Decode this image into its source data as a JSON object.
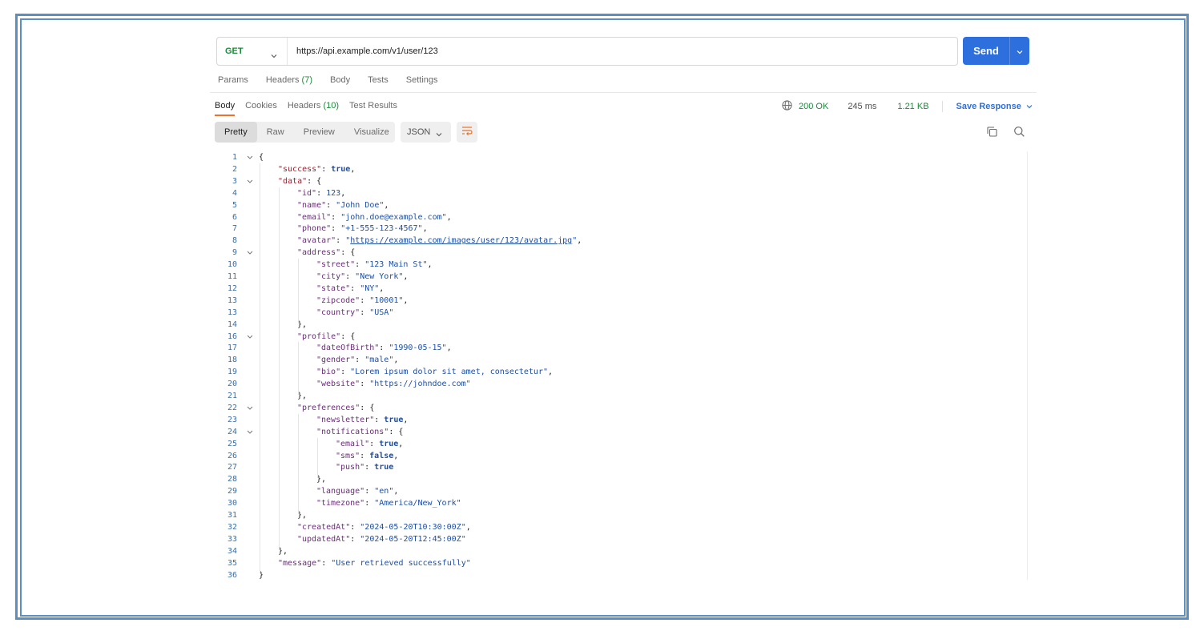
{
  "request": {
    "method": "GET",
    "url": "https://api.example.com/v1/user/123",
    "send_label": "Send",
    "tabs": [
      {
        "label": "Params",
        "count": ""
      },
      {
        "label": "Headers",
        "count": "(7)"
      },
      {
        "label": "Body",
        "count": ""
      },
      {
        "label": "Tests",
        "count": ""
      },
      {
        "label": "Settings",
        "count": ""
      }
    ]
  },
  "response": {
    "tabs": [
      {
        "label": "Body",
        "count": ""
      },
      {
        "label": "Cookies",
        "count": ""
      },
      {
        "label": "Headers",
        "count": "(10)"
      },
      {
        "label": "Test Results",
        "count": ""
      }
    ],
    "status": "200 OK",
    "time": "245 ms",
    "size": "1.21 KB",
    "save_label": "Save Response",
    "views": [
      "Pretty",
      "Raw",
      "Preview",
      "Visualize"
    ],
    "format": "JSON"
  },
  "code_lines": [
    {
      "n": "1",
      "indent": 0,
      "fold": true,
      "tokens": [
        [
          "p",
          "{"
        ]
      ]
    },
    {
      "n": "2",
      "indent": 1,
      "fold": false,
      "tokens": [
        [
          "k",
          "\"success\""
        ],
        [
          "p",
          ": "
        ],
        [
          "b",
          "true"
        ],
        [
          "p",
          ","
        ]
      ]
    },
    {
      "n": "3",
      "indent": 1,
      "fold": true,
      "tokens": [
        [
          "k",
          "\"data\""
        ],
        [
          "p",
          ": {"
        ]
      ]
    },
    {
      "n": "4",
      "indent": 2,
      "fold": false,
      "tokens": [
        [
          "k2",
          "\"id\""
        ],
        [
          "p",
          ": "
        ],
        [
          "n",
          "123"
        ],
        [
          "p",
          ","
        ]
      ]
    },
    {
      "n": "5",
      "indent": 2,
      "fold": false,
      "tokens": [
        [
          "k2",
          "\"name\""
        ],
        [
          "p",
          ": "
        ],
        [
          "s",
          "\"John Doe\""
        ],
        [
          "p",
          ","
        ]
      ]
    },
    {
      "n": "6",
      "indent": 2,
      "fold": false,
      "tokens": [
        [
          "k2",
          "\"email\""
        ],
        [
          "p",
          ": "
        ],
        [
          "s",
          "\"john.doe@example.com\""
        ],
        [
          "p",
          ","
        ]
      ]
    },
    {
      "n": "7",
      "indent": 2,
      "fold": false,
      "tokens": [
        [
          "k2",
          "\"phone\""
        ],
        [
          "p",
          ": "
        ],
        [
          "s",
          "\"+1-555-123-4567\""
        ],
        [
          "p",
          ","
        ]
      ]
    },
    {
      "n": "8",
      "indent": 2,
      "fold": false,
      "tokens": [
        [
          "k2",
          "\"avatar\""
        ],
        [
          "p",
          ": "
        ],
        [
          "s",
          "\""
        ],
        [
          "u",
          "https://example.com/images/user/123/avatar.jpg"
        ],
        [
          "s",
          "\""
        ],
        [
          "p",
          ","
        ]
      ]
    },
    {
      "n": "9",
      "indent": 2,
      "fold": true,
      "tokens": [
        [
          "k2",
          "\"address\""
        ],
        [
          "p",
          ": {"
        ]
      ]
    },
    {
      "n": "10",
      "indent": 3,
      "fold": false,
      "tokens": [
        [
          "k2",
          "\"street\""
        ],
        [
          "p",
          ": "
        ],
        [
          "s",
          "\"123 Main St\""
        ],
        [
          "p",
          ","
        ]
      ]
    },
    {
      "n": "11",
      "indent": 3,
      "fold": false,
      "tokens": [
        [
          "k2",
          "\"city\""
        ],
        [
          "p",
          ": "
        ],
        [
          "s",
          "\"New York\""
        ],
        [
          "p",
          ","
        ]
      ]
    },
    {
      "n": "12",
      "indent": 3,
      "fold": false,
      "tokens": [
        [
          "k2",
          "\"state\""
        ],
        [
          "p",
          ": "
        ],
        [
          "s",
          "\"NY\""
        ],
        [
          "p",
          ","
        ]
      ]
    },
    {
      "n": "13",
      "indent": 3,
      "fold": false,
      "tokens": [
        [
          "k2",
          "\"zipcode\""
        ],
        [
          "p",
          ": "
        ],
        [
          "s",
          "\"10001\""
        ],
        [
          "p",
          ","
        ]
      ]
    },
    {
      "n": "13",
      "indent": 3,
      "fold": false,
      "tokens": [
        [
          "k2",
          "\"country\""
        ],
        [
          "p",
          ": "
        ],
        [
          "s",
          "\"USA\""
        ]
      ]
    },
    {
      "n": "14",
      "indent": 2,
      "fold": false,
      "tokens": [
        [
          "p",
          "},"
        ]
      ]
    },
    {
      "n": "16",
      "indent": 2,
      "fold": true,
      "tokens": [
        [
          "k2",
          "\"profile\""
        ],
        [
          "p",
          ": {"
        ]
      ]
    },
    {
      "n": "17",
      "indent": 3,
      "fold": false,
      "tokens": [
        [
          "k2",
          "\"dateOfBirth\""
        ],
        [
          "p",
          ": "
        ],
        [
          "s",
          "\"1990-05-15\""
        ],
        [
          "p",
          ","
        ]
      ]
    },
    {
      "n": "18",
      "indent": 3,
      "fold": false,
      "tokens": [
        [
          "k2",
          "\"gender\""
        ],
        [
          "p",
          ": "
        ],
        [
          "s",
          "\"male\""
        ],
        [
          "p",
          ","
        ]
      ]
    },
    {
      "n": "19",
      "indent": 3,
      "fold": false,
      "tokens": [
        [
          "k2",
          "\"bio\""
        ],
        [
          "p",
          ": "
        ],
        [
          "s",
          "\"Lorem ipsum dolor sit amet, consectetur\""
        ],
        [
          "p",
          ","
        ]
      ]
    },
    {
      "n": "20",
      "indent": 3,
      "fold": false,
      "tokens": [
        [
          "k2",
          "\"website\""
        ],
        [
          "p",
          ": "
        ],
        [
          "s",
          "\"https://johndoe.com\""
        ]
      ]
    },
    {
      "n": "21",
      "indent": 2,
      "fold": false,
      "tokens": [
        [
          "p",
          "},"
        ]
      ]
    },
    {
      "n": "22",
      "indent": 2,
      "fold": true,
      "tokens": [
        [
          "k2",
          "\"preferences\""
        ],
        [
          "p",
          ": {"
        ]
      ]
    },
    {
      "n": "23",
      "indent": 3,
      "fold": false,
      "tokens": [
        [
          "k2",
          "\"newsletter\""
        ],
        [
          "p",
          ": "
        ],
        [
          "b",
          "true"
        ],
        [
          "p",
          ","
        ]
      ]
    },
    {
      "n": "24",
      "indent": 3,
      "fold": true,
      "tokens": [
        [
          "k2",
          "\"notifications\""
        ],
        [
          "p",
          ": {"
        ]
      ]
    },
    {
      "n": "25",
      "indent": 4,
      "fold": false,
      "tokens": [
        [
          "k2",
          "\"email\""
        ],
        [
          "p",
          ": "
        ],
        [
          "b",
          "true"
        ],
        [
          "p",
          ","
        ]
      ]
    },
    {
      "n": "26",
      "indent": 4,
      "fold": false,
      "tokens": [
        [
          "k2",
          "\"sms\""
        ],
        [
          "p",
          ": "
        ],
        [
          "b",
          "false"
        ],
        [
          "p",
          ","
        ]
      ]
    },
    {
      "n": "27",
      "indent": 4,
      "fold": false,
      "tokens": [
        [
          "k2",
          "\"push\""
        ],
        [
          "p",
          ": "
        ],
        [
          "b",
          "true"
        ]
      ]
    },
    {
      "n": "28",
      "indent": 3,
      "fold": false,
      "tokens": [
        [
          "p",
          "},"
        ]
      ]
    },
    {
      "n": "29",
      "indent": 3,
      "fold": false,
      "tokens": [
        [
          "k2",
          "\"language\""
        ],
        [
          "p",
          ": "
        ],
        [
          "s",
          "\"en\""
        ],
        [
          "p",
          ","
        ]
      ]
    },
    {
      "n": "30",
      "indent": 3,
      "fold": false,
      "tokens": [
        [
          "k2",
          "\"timezone\""
        ],
        [
          "p",
          ": "
        ],
        [
          "s",
          "\"America/New_York\""
        ]
      ]
    },
    {
      "n": "31",
      "indent": 2,
      "fold": false,
      "tokens": [
        [
          "p",
          "},"
        ]
      ]
    },
    {
      "n": "32",
      "indent": 2,
      "fold": false,
      "tokens": [
        [
          "k2",
          "\"createdAt\""
        ],
        [
          "p",
          ": "
        ],
        [
          "s",
          "\"2024-05-20T10:30:00Z\""
        ],
        [
          "p",
          ","
        ]
      ]
    },
    {
      "n": "33",
      "indent": 2,
      "fold": false,
      "tokens": [
        [
          "k2",
          "\"updatedAt\""
        ],
        [
          "p",
          ": "
        ],
        [
          "s",
          "\"2024-05-20T12:45:00Z\""
        ]
      ]
    },
    {
      "n": "34",
      "indent": 1,
      "fold": false,
      "tokens": [
        [
          "p",
          "},"
        ]
      ]
    },
    {
      "n": "35",
      "indent": 1,
      "fold": false,
      "tokens": [
        [
          "k2",
          "\"message\""
        ],
        [
          "p",
          ": "
        ],
        [
          "s",
          "\"User retrieved successfully\""
        ]
      ]
    },
    {
      "n": "36",
      "indent": 0,
      "fold": false,
      "tokens": [
        [
          "p",
          "}"
        ]
      ]
    }
  ],
  "colors": {
    "accent": "#2d6fdc",
    "success": "#1c8a3a",
    "active_tab": "#e8732c",
    "frame": "#5b8ec2"
  },
  "icons": [
    "chevron-down-icon",
    "globe-icon",
    "wrap-lines-icon",
    "copy-icon",
    "search-icon"
  ]
}
